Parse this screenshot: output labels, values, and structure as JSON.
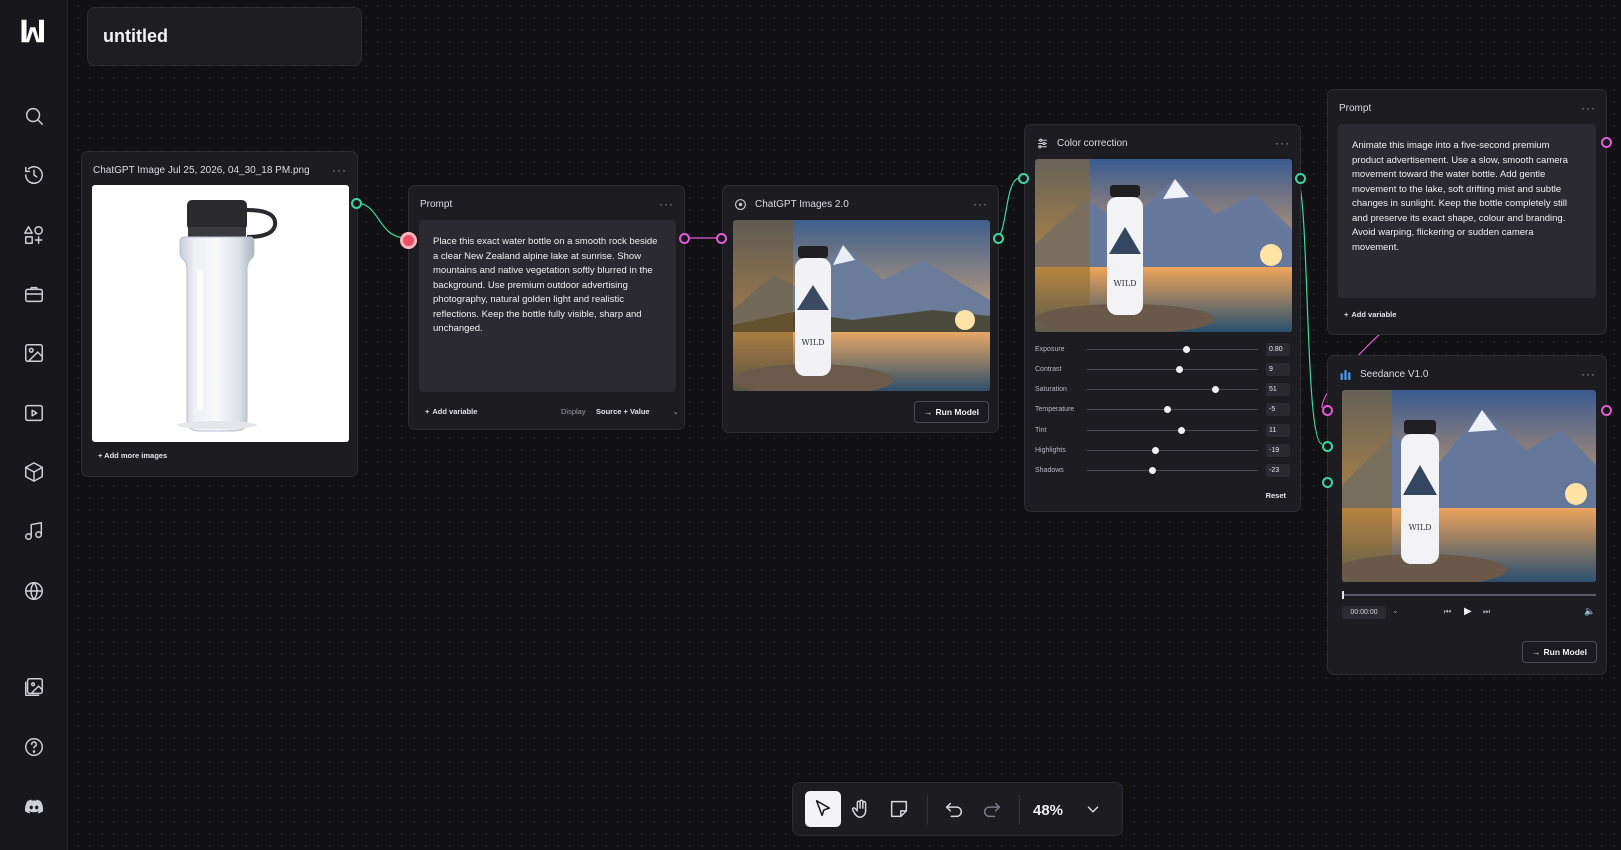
{
  "project": {
    "title": "untitled"
  },
  "sidebar": {
    "items": [
      {
        "icon": "logo-icon"
      },
      {
        "icon": "search-icon"
      },
      {
        "icon": "history-icon"
      },
      {
        "icon": "shapes-icon"
      },
      {
        "icon": "toolbox-icon"
      },
      {
        "icon": "image-icon"
      },
      {
        "icon": "video-icon"
      },
      {
        "icon": "cube-icon"
      },
      {
        "icon": "music-icon"
      },
      {
        "icon": "globe-icon"
      },
      {
        "icon": "gallery-icon"
      },
      {
        "icon": "help-icon"
      },
      {
        "icon": "discord-icon"
      }
    ]
  },
  "image_node": {
    "title": "ChatGPT Image Jul 25, 2026, 04_30_18 PM.png",
    "add_more": "+ Add more images"
  },
  "prompt_node_1": {
    "title": "Prompt",
    "text": "Place this exact water bottle on a smooth rock beside a clear New Zealand alpine lake at sunrise. Show mountains and native vegetation softly blurred in the background. Use premium outdoor advertising photography, natural golden light and realistic reflections. Keep the bottle fully visible, sharp and unchanged.",
    "add_variable": "Add variable",
    "display_label": "Display",
    "display_value": "Source + Value"
  },
  "chatgpt_node": {
    "title": "ChatGPT Images 2.0",
    "run": "Run Model"
  },
  "color_node": {
    "title": "Color correction",
    "sliders": [
      {
        "label": "Exposure",
        "value": "0.80",
        "pos": 0.58
      },
      {
        "label": "Contrast",
        "value": "9",
        "pos": 0.54
      },
      {
        "label": "Saturation",
        "value": "51",
        "pos": 0.75
      },
      {
        "label": "Temperature",
        "value": "-5",
        "pos": 0.47
      },
      {
        "label": "Tint",
        "value": "11",
        "pos": 0.55
      },
      {
        "label": "Highlights",
        "value": "-19",
        "pos": 0.4
      },
      {
        "label": "Shadows",
        "value": "-23",
        "pos": 0.38
      }
    ],
    "reset": "Reset"
  },
  "prompt_node_2": {
    "title": "Prompt",
    "text": "Animate this image into a five-second premium product advertisement. Use a slow, smooth camera movement toward the water bottle. Add gentle movement to the lake, soft drifting mist and subtle changes in sunlight. Keep the bottle completely still and preserve its exact shape, colour and branding. Avoid warping, flickering or sudden camera movement.",
    "add_variable": "Add variable"
  },
  "seedance_node": {
    "title": "Seedance V1.0",
    "timecode": "00:00:00",
    "run": "Run Model"
  },
  "bottle_label": "WILD",
  "toolbar": {
    "zoom": "48%"
  },
  "colors": {
    "accent_green": "#3dd6a3",
    "accent_pink": "#e25ad8",
    "accent_red": "#ef4d62"
  }
}
